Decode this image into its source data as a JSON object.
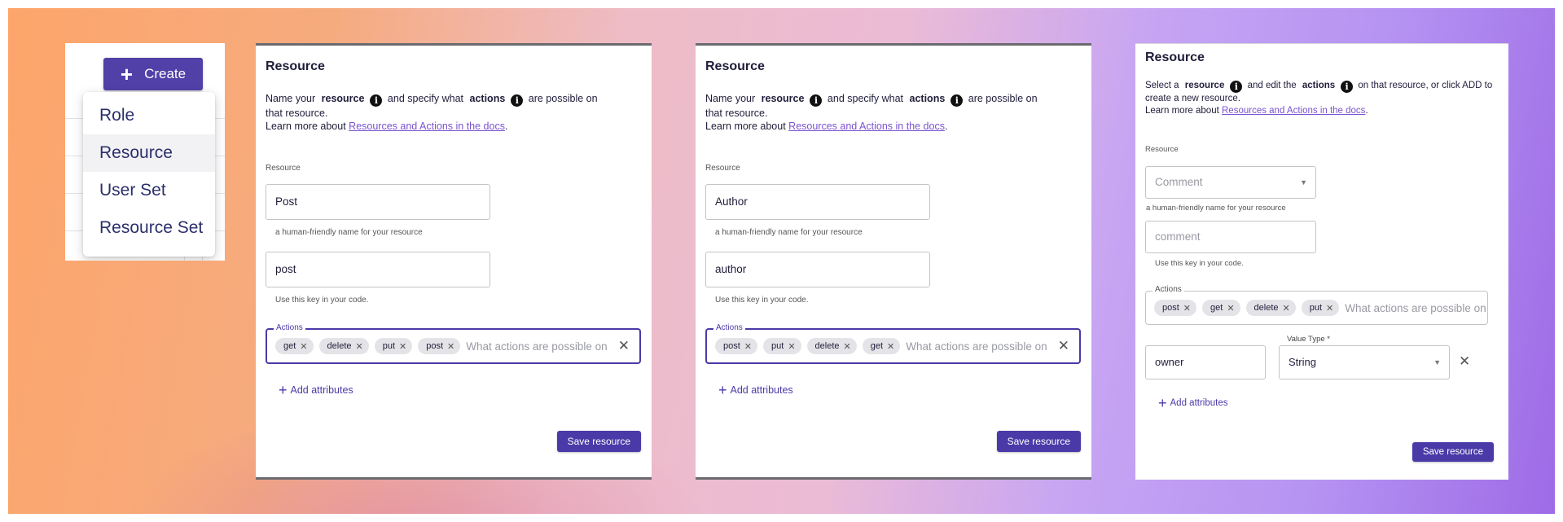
{
  "menu": {
    "create_label": "Create",
    "items": [
      "Role",
      "Resource",
      "User Set",
      "Resource Set"
    ],
    "active_index": 1
  },
  "panels": [
    {
      "title": "Resource",
      "desc_pre": "Name your",
      "desc_b1": "resource",
      "desc_mid": "and specify what",
      "desc_b2": "actions",
      "desc_post": "are possible on that resource.",
      "learn_more": "Learn more about",
      "doc_link": "Resources and Actions in the docs",
      "resource_label": "Resource",
      "name_value": "Post",
      "name_helper": "a human-friendly name for your resource",
      "key_value": "post",
      "key_helper": "Use this key in your code.",
      "actions_label": "Actions",
      "chips": [
        "get",
        "delete",
        "put",
        "post"
      ],
      "actions_placeholder": "What actions are possible on Post?",
      "add_attributes": "Add attributes",
      "save": "Save resource"
    },
    {
      "title": "Resource",
      "desc_pre": "Name your",
      "desc_b1": "resource",
      "desc_mid": "and specify what",
      "desc_b2": "actions",
      "desc_post": "are possible on that resource.",
      "learn_more": "Learn more about",
      "doc_link": "Resources and Actions in the docs",
      "resource_label": "Resource",
      "name_value": "Author",
      "name_helper": "a human-friendly name for your resource",
      "key_value": "author",
      "key_helper": "Use this key in your code.",
      "actions_label": "Actions",
      "chips": [
        "post",
        "put",
        "delete",
        "get"
      ],
      "actions_placeholder": "What actions are possible on Author?",
      "add_attributes": "Add attributes",
      "save": "Save resource"
    }
  ],
  "panel3": {
    "title": "Resource",
    "desc_pre": "Select a",
    "desc_b1": "resource",
    "desc_mid": "and edit the",
    "desc_b2": "actions",
    "desc_post": "on that resource, or click ADD to create a new resource.",
    "learn_more": "Learn more about",
    "doc_link": "Resources and Actions in the docs",
    "resource_label": "Resource",
    "select_value": "Comment",
    "name_helper": "a human-friendly name for your resource",
    "key_value": "comment",
    "key_helper": "Use this key in your code.",
    "actions_label": "Actions",
    "chips": [
      "post",
      "get",
      "delete",
      "put"
    ],
    "actions_placeholder": "What actions are possible on res...",
    "attr_value": "owner",
    "value_type_label": "Value Type *",
    "value_type": "String",
    "add_attributes": "Add attributes",
    "save": "Save resource"
  },
  "colors": {
    "primary": "#4a3aa8",
    "create_button": "#5140a8",
    "link": "#7a52d0"
  }
}
